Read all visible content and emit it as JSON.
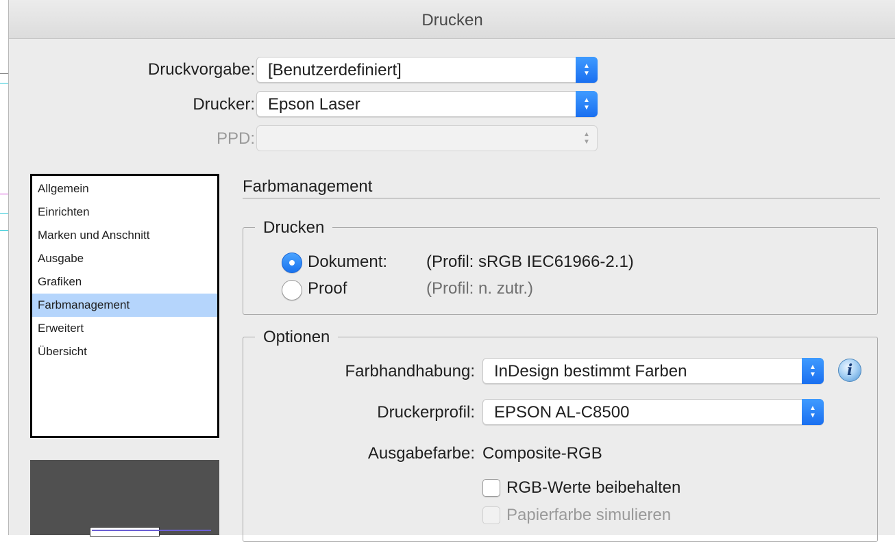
{
  "window": {
    "title": "Drucken"
  },
  "top": {
    "preset_label": "Druckvorgabe:",
    "preset_value": "[Benutzerdefiniert]",
    "printer_label": "Drucker:",
    "printer_value": "Epson Laser",
    "ppd_label": "PPD:",
    "ppd_value": ""
  },
  "sidebar": {
    "items": [
      {
        "label": "Allgemein"
      },
      {
        "label": "Einrichten"
      },
      {
        "label": "Marken und Anschnitt"
      },
      {
        "label": "Ausgabe"
      },
      {
        "label": "Grafiken"
      },
      {
        "label": "Farbmanagement",
        "selected": true
      },
      {
        "label": "Erweitert"
      },
      {
        "label": "Übersicht"
      }
    ]
  },
  "panel": {
    "title": "Farbmanagement",
    "print_group": {
      "legend": "Drucken",
      "document_label": "Dokument:",
      "document_profile": "(Profil: sRGB IEC61966-2.1)",
      "proof_label": "Proof",
      "proof_profile": "(Profil: n. zutr.)",
      "selected": "document"
    },
    "options_group": {
      "legend": "Optionen",
      "color_handling_label": "Farbhandhabung:",
      "color_handling_value": "InDesign bestimmt Farben",
      "printer_profile_label": "Druckerprofil:",
      "printer_profile_value": "EPSON AL-C8500",
      "output_color_label": "Ausgabefarbe:",
      "output_color_value": "Composite-RGB",
      "keep_rgb_label": "RGB-Werte beibehalten",
      "keep_rgb_checked": false,
      "simulate_paper_label": "Papierfarbe simulieren",
      "simulate_paper_checked": false,
      "info_glyph": "i"
    }
  },
  "colors": {
    "accent": "#1a73ee",
    "selection": "#b5d5fc",
    "dialog_bg": "#ececec"
  }
}
